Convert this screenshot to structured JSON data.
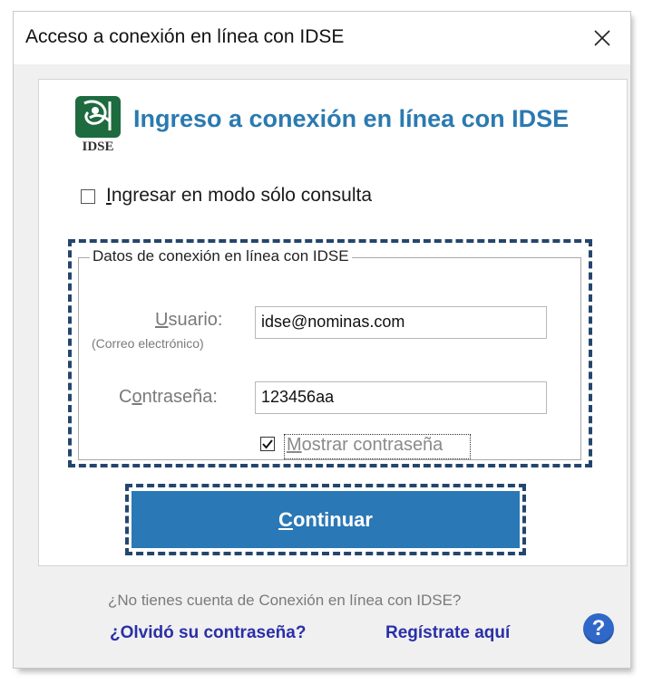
{
  "window": {
    "title": "Acceso a conexión en línea con IDSE"
  },
  "header": {
    "logo_text": "IDSE",
    "title": "Ingreso a conexión en línea con IDSE"
  },
  "readonly_mode": {
    "label": "Ingresar en modo sólo consulta",
    "checked": false
  },
  "connection_group": {
    "legend": "Datos de conexión en línea con IDSE",
    "user_label": "Usuario:",
    "user_hint": "(Correo electrónico)",
    "user_value": "idse@nominas.com",
    "password_label": "Contraseña:",
    "password_value": "123456aa",
    "show_password_label": "Mostrar contraseña",
    "show_password_checked": true
  },
  "actions": {
    "continue_label": "Continuar"
  },
  "footer": {
    "question": "¿No tienes cuenta de Conexión en línea con IDSE?",
    "forgot_link": "¿Olvidó su contraseña?",
    "register_link": "Regístrate aquí",
    "help_icon": "help-icon"
  },
  "colors": {
    "accent": "#2a78b6",
    "heading": "#2a7ab0",
    "link": "#2a2fa8",
    "highlight_border": "#24466e"
  }
}
